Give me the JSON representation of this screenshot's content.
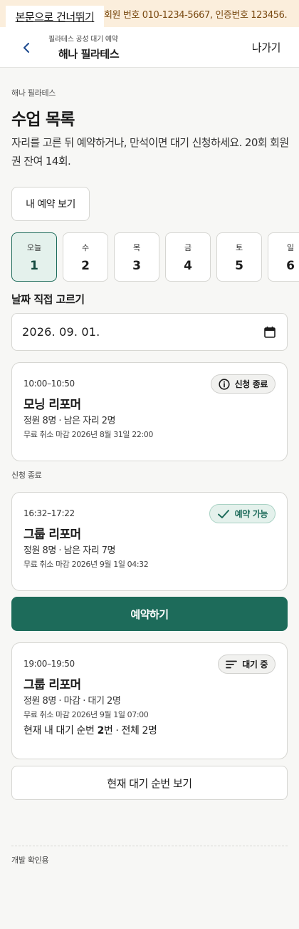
{
  "banner": {
    "skip_link": "본문으로 건너뛰기",
    "info": "회원 번호 010-1234-5667, 인증번호 123456."
  },
  "header": {
    "subtitle": "필라테스 공성 대기 예약",
    "title": "해나 필라테스",
    "exit_label": "나가기",
    "back_icon": "chevron-left-icon"
  },
  "page": {
    "eyebrow": "해나 필라테스",
    "title": "수업 목록",
    "description": "자리를 고른 뒤 예약하거나, 만석이면 대기 신청하세요. 20회 회원권 잔여 14회.",
    "my_reservations_label": "내 예약 보기"
  },
  "days": [
    {
      "label": "오늘",
      "num": "1",
      "selected": true
    },
    {
      "label": "수",
      "num": "2",
      "selected": false
    },
    {
      "label": "목",
      "num": "3",
      "selected": false
    },
    {
      "label": "금",
      "num": "4",
      "selected": false
    },
    {
      "label": "토",
      "num": "5",
      "selected": false
    },
    {
      "label": "일",
      "num": "6",
      "selected": false
    }
  ],
  "date_picker": {
    "label": "날짜 직접 고르기",
    "value": "2026. 09. 01.",
    "icon": "calendar-icon"
  },
  "classes": [
    {
      "time": "10:00–10:50",
      "name": "모닝 리포머",
      "capacity": "정원 8명 · 남은 자리 2명",
      "cancel": "무료 취소 마감 2026년 8월 31일 22:00",
      "badge": "신청 종료",
      "badge_icon": "info-icon"
    },
    {
      "time": "16:32–17:22",
      "name": "그룹 리포머",
      "capacity": "정원 8명 · 남은 자리 7명",
      "cancel": "무료 취소 마감 2026년 9월 1일 04:32",
      "badge": "예약 가능",
      "badge_icon": "check-icon"
    },
    {
      "time": "19:00–19:50",
      "name": "그룹 리포머",
      "capacity": "정원 8명 · 마감 · 대기 2명",
      "cancel": "무료 취소 마감 2026년 9월 1일 07:00",
      "badge": "대기 중",
      "badge_icon": "list-icon",
      "queue_prefix": "현재 내 대기 순번 ",
      "queue_number": "2",
      "queue_suffix": "번 · 전체 2명"
    }
  ],
  "status_note": "신청 종료",
  "actions": {
    "reserve_label": "예약하기",
    "view_queue_label": "현재 대기 순번 보기"
  },
  "footer": {
    "dev_note": "개발 확인용"
  },
  "colors": {
    "accent": "#1d6b5a",
    "accent_light": "#e4f1ec",
    "banner_bg": "#fbeedc",
    "background": "#f7f7f5"
  }
}
